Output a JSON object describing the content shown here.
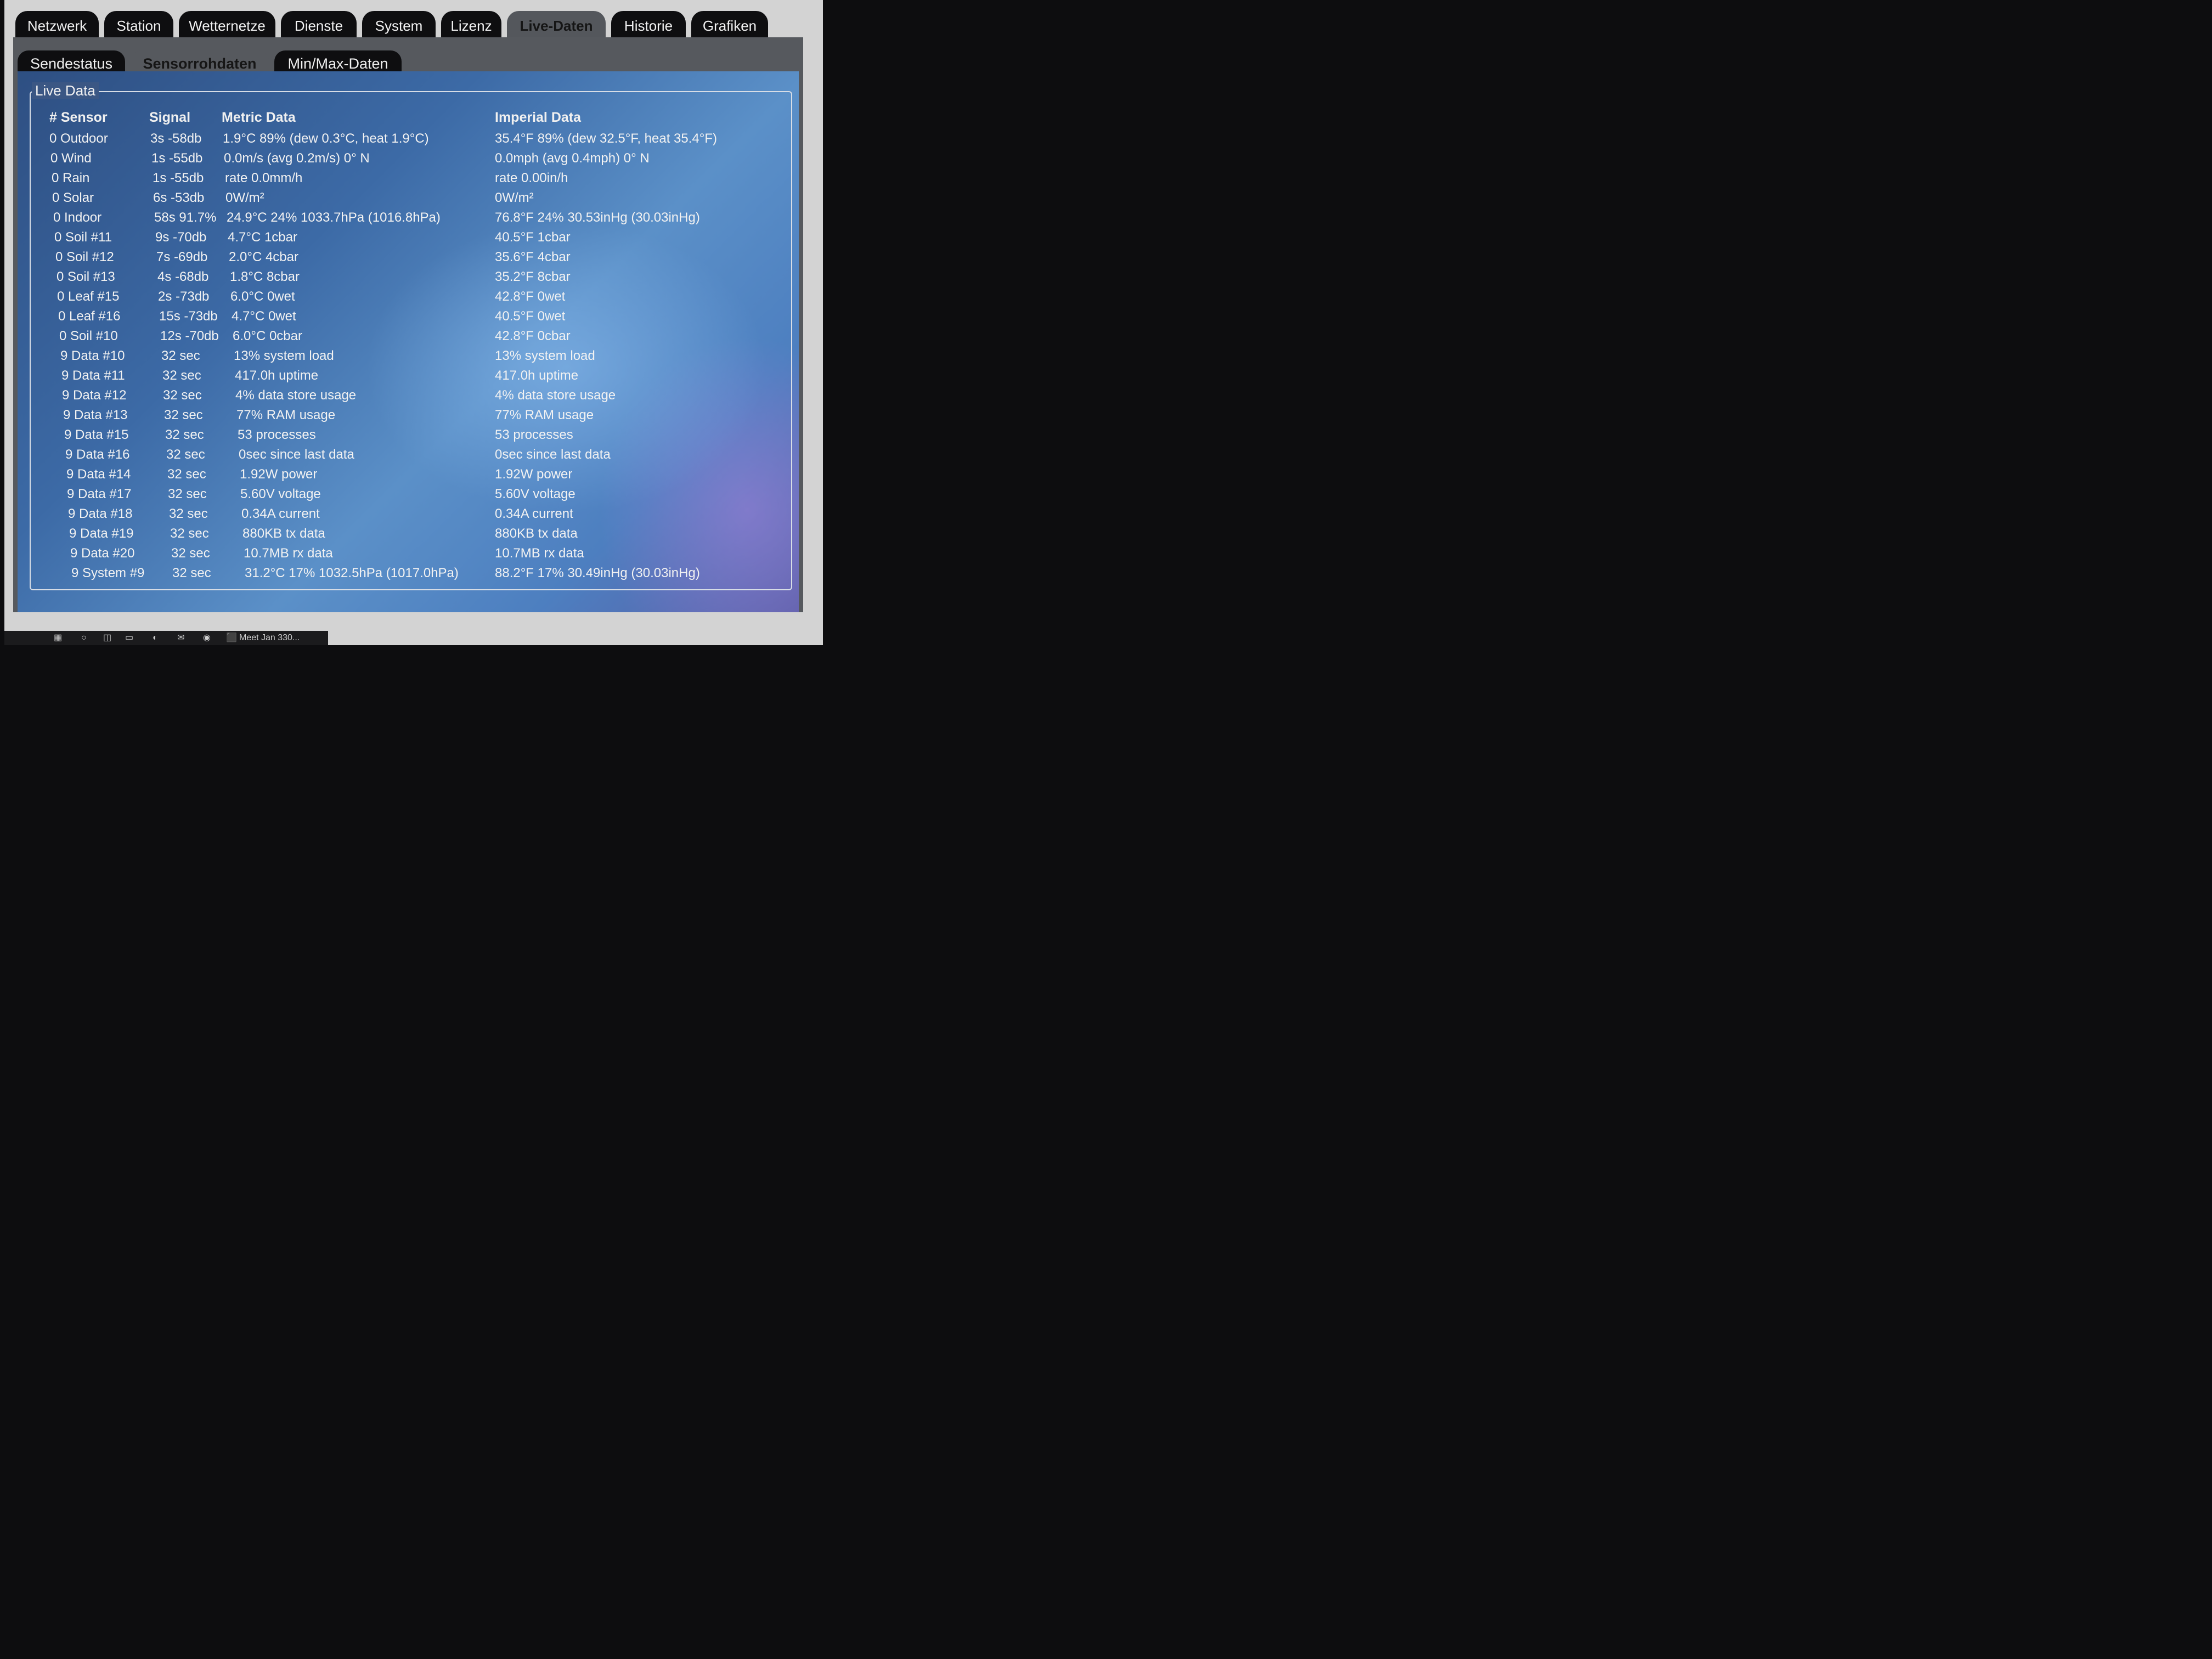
{
  "top_tabs": [
    "Netzwerk",
    "Station",
    "Wetternetze",
    "Dienste",
    "System",
    "Lizenz",
    "Live-Daten",
    "Historie",
    "Grafiken"
  ],
  "active_top_tab": "Live-Daten",
  "sub_tabs": [
    "Sendestatus",
    "Sensorrohdaten",
    "Min/Max-Daten"
  ],
  "active_sub_tab": "Sensorrohdaten",
  "live_data": {
    "legend": "Live Data",
    "headers": {
      "sensor": "# Sensor",
      "signal": "Signal",
      "metric": "Metric Data",
      "imperial": "Imperial Data"
    },
    "rows": [
      {
        "sensor": "0 Outdoor",
        "signal": "3s -58db",
        "metric": "1.9°C 89% (dew 0.3°C, heat 1.9°C)",
        "imperial": "35.4°F 89% (dew 32.5°F, heat 35.4°F)"
      },
      {
        "sensor": "0 Wind",
        "signal": "1s -55db",
        "metric": "0.0m/s (avg 0.2m/s) 0° N",
        "imperial": "0.0mph (avg 0.4mph) 0° N"
      },
      {
        "sensor": "0 Rain",
        "signal": "1s -55db",
        "metric": "rate 0.0mm/h",
        "imperial": "rate 0.00in/h"
      },
      {
        "sensor": "0 Solar",
        "signal": "6s -53db",
        "metric": "0W/m²",
        "imperial": "0W/m²"
      },
      {
        "sensor": "0 Indoor",
        "signal": "58s 91.7%",
        "metric": "24.9°C 24% 1033.7hPa (1016.8hPa)",
        "imperial": "76.8°F 24% 30.53inHg (30.03inHg)"
      },
      {
        "sensor": "0 Soil #11",
        "signal": "9s -70db",
        "metric": "4.7°C 1cbar",
        "imperial": "40.5°F 1cbar"
      },
      {
        "sensor": "0 Soil #12",
        "signal": "7s -69db",
        "metric": "2.0°C 4cbar",
        "imperial": "35.6°F 4cbar"
      },
      {
        "sensor": "0 Soil #13",
        "signal": "4s -68db",
        "metric": "1.8°C 8cbar",
        "imperial": "35.2°F 8cbar"
      },
      {
        "sensor": "0 Leaf #15",
        "signal": "2s -73db",
        "metric": "6.0°C 0wet",
        "imperial": "42.8°F 0wet"
      },
      {
        "sensor": "0 Leaf #16",
        "signal": "15s -73db",
        "metric": "4.7°C 0wet",
        "imperial": "40.5°F 0wet"
      },
      {
        "sensor": "0 Soil #10",
        "signal": "12s -70db",
        "metric": "6.0°C 0cbar",
        "imperial": "42.8°F 0cbar"
      },
      {
        "sensor": "9 Data #10",
        "signal": "32 sec",
        "metric": "13% system load",
        "imperial": "13% system load"
      },
      {
        "sensor": "9 Data #11",
        "signal": "32 sec",
        "metric": "417.0h uptime",
        "imperial": "417.0h uptime"
      },
      {
        "sensor": "9 Data #12",
        "signal": "32 sec",
        "metric": "4% data store usage",
        "imperial": "4% data store usage"
      },
      {
        "sensor": "9 Data #13",
        "signal": "32 sec",
        "metric": "77% RAM usage",
        "imperial": "77% RAM usage"
      },
      {
        "sensor": "9 Data #15",
        "signal": "32 sec",
        "metric": "53 processes",
        "imperial": "53 processes"
      },
      {
        "sensor": "9 Data #16",
        "signal": "32 sec",
        "metric": "0sec since last data",
        "imperial": "0sec since last data"
      },
      {
        "sensor": "9 Data #14",
        "signal": "32 sec",
        "metric": "1.92W power",
        "imperial": "1.92W power"
      },
      {
        "sensor": "9 Data #17",
        "signal": "32 sec",
        "metric": "5.60V voltage",
        "imperial": "5.60V voltage"
      },
      {
        "sensor": "9 Data #18",
        "signal": "32 sec",
        "metric": "0.34A current",
        "imperial": "0.34A current"
      },
      {
        "sensor": "9 Data #19",
        "signal": "32 sec",
        "metric": "880KB tx data",
        "imperial": "880KB tx data"
      },
      {
        "sensor": "9 Data #20",
        "signal": "32 sec",
        "metric": "10.7MB rx data",
        "imperial": "10.7MB rx data"
      },
      {
        "sensor": "9 System #9",
        "signal": "32 sec",
        "metric": "31.2°C 17% 1032.5hPa (1017.0hPa)",
        "imperial": "88.2°F 17% 30.49inHg (30.03inHg)"
      }
    ]
  },
  "taskbar": {
    "item_label": "Meet Jan 330..."
  }
}
